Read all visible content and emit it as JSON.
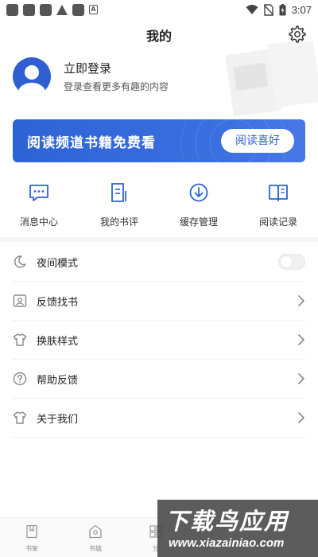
{
  "status_bar": {
    "time": "3:07",
    "icons": [
      "notification-icon",
      "notification-icon",
      "notification-icon",
      "warning-icon",
      "notification-icon",
      "a-icon",
      "wifi-icon",
      "no-sim-icon",
      "battery-icon"
    ]
  },
  "header": {
    "title": "我的",
    "settings_icon": "gear-icon"
  },
  "profile": {
    "title": "立即登录",
    "subtitle": "登录查看更多有趣的内容"
  },
  "banner": {
    "text": "阅读频道书籍免费看",
    "button": "阅读喜好",
    "accent": "#2e63d6"
  },
  "quick_actions": [
    {
      "label": "消息中心",
      "icon": "message-icon"
    },
    {
      "label": "我的书评",
      "icon": "review-icon"
    },
    {
      "label": "缓存管理",
      "icon": "download-icon"
    },
    {
      "label": "阅读记录",
      "icon": "book-open-icon"
    }
  ],
  "settings": [
    {
      "label": "夜间模式",
      "icon": "moon-icon",
      "control": "toggle",
      "on": false
    },
    {
      "label": "反馈找书",
      "icon": "search-book-icon",
      "control": "chevron"
    },
    {
      "label": "换肤样式",
      "icon": "shirt-icon",
      "control": "chevron"
    },
    {
      "label": "帮助反馈",
      "icon": "help-icon",
      "control": "chevron"
    },
    {
      "label": "关于我们",
      "icon": "shirt-icon",
      "control": "chevron"
    }
  ],
  "bottom_nav": [
    {
      "label": "书架",
      "icon": "bookshelf-icon"
    },
    {
      "label": "书城",
      "icon": "store-icon"
    },
    {
      "label": "分",
      "icon": "category-icon"
    }
  ],
  "watermark": {
    "big": "下载鸟应用",
    "small": "www.xiazainiao.com"
  }
}
